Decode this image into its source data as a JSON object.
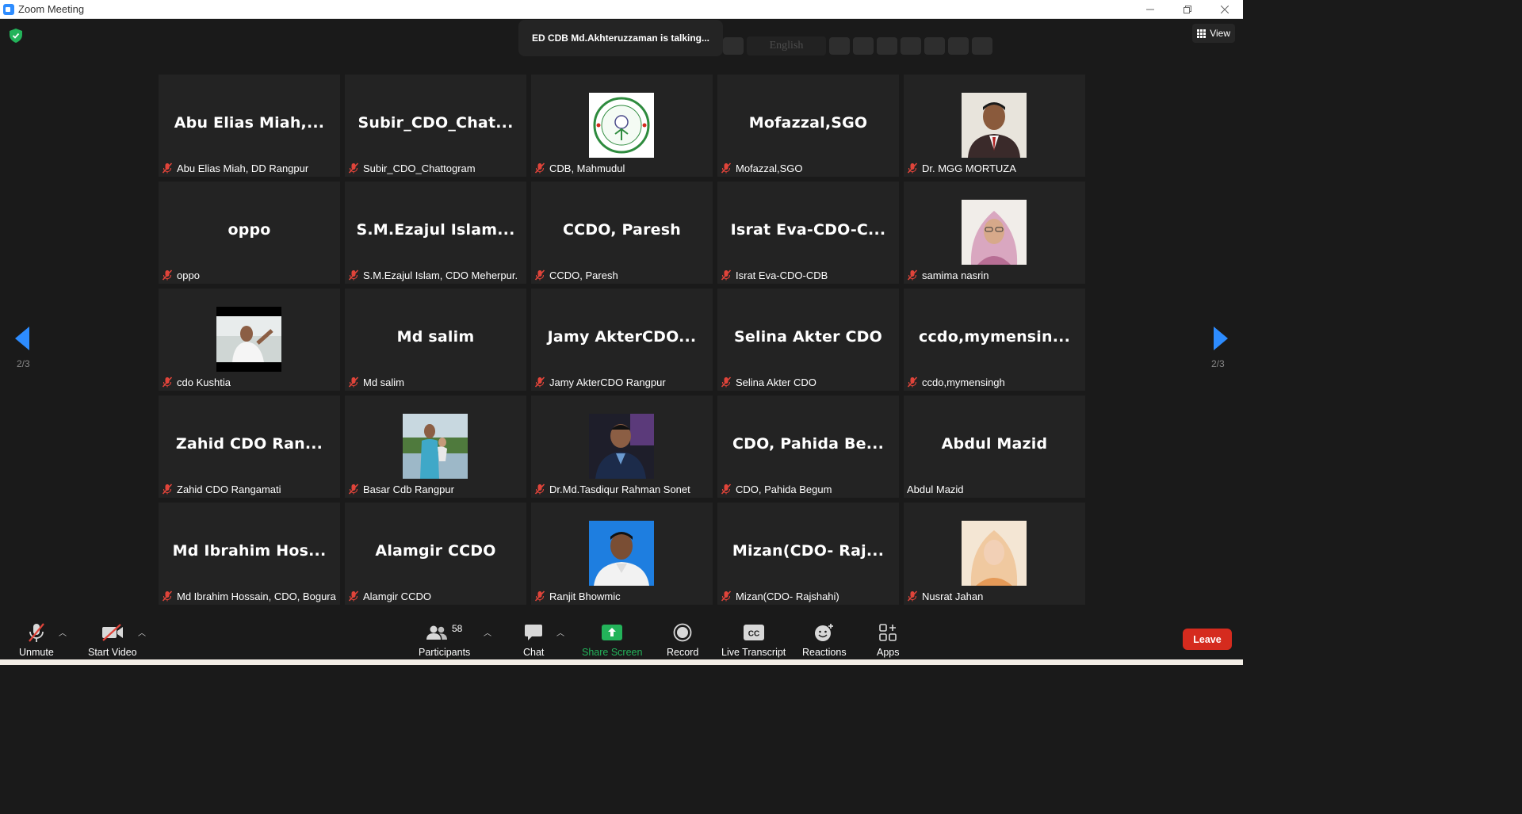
{
  "window": {
    "title": "Zoom Meeting",
    "controls": [
      "minimize-icon",
      "restore-icon",
      "close-icon"
    ]
  },
  "meeting": {
    "talking_indicator": "ED CDB Md.Akhteruzzaman is talking...",
    "interpretation_language": "English",
    "view_label": "View",
    "page_left": "2/3",
    "page_right": "2/3"
  },
  "tiles": [
    {
      "big": "Abu  Elias  Miah,...",
      "label": "Abu Elias Miah, DD Rangpur",
      "muted": true
    },
    {
      "big": "Subir_CDO_Chat...",
      "label": "Subir_CDO_Chattogram",
      "muted": true
    },
    {
      "big": "",
      "label": "CDB, Mahmudul",
      "muted": true,
      "photo": "logo"
    },
    {
      "big": "Mofazzal,SGO",
      "label": "Mofazzal,SGO",
      "muted": true
    },
    {
      "big": "",
      "label": "Dr. MGG MORTUZA",
      "muted": true,
      "photo": "man-suit"
    },
    {
      "big": "oppo",
      "label": "oppo",
      "muted": true
    },
    {
      "big": "S.M.Ezajul  Islam...",
      "label": "S.M.Ezajul Islam, CDO Meherpur.",
      "muted": true
    },
    {
      "big": "CCDO, Paresh",
      "label": "CCDO, Paresh",
      "muted": true
    },
    {
      "big": "Israt  Eva-CDO-C...",
      "label": "Israt Eva-CDO-CDB",
      "muted": true
    },
    {
      "big": "",
      "label": "samima nasrin",
      "muted": true,
      "photo": "woman-hijab"
    },
    {
      "big": "",
      "label": "cdo Kushtia",
      "muted": true,
      "photo": "man-outdoor"
    },
    {
      "big": "Md salim",
      "label": "Md salim",
      "muted": true
    },
    {
      "big": "Jamy  AkterCDO...",
      "label": "Jamy AkterCDO Rangpur",
      "muted": true
    },
    {
      "big": "Selina Akter CDO",
      "label": "Selina Akter CDO",
      "muted": true
    },
    {
      "big": "ccdo,mymensin...",
      "label": "ccdo,mymensingh",
      "muted": true
    },
    {
      "big": "Zahid  CDO  Ran...",
      "label": "Zahid CDO Rangamati",
      "muted": true
    },
    {
      "big": "",
      "label": "Basar Cdb Rangpur",
      "muted": true,
      "photo": "man-child"
    },
    {
      "big": "",
      "label": "Dr.Md.Tasdiqur Rahman Sonet",
      "muted": true,
      "photo": "man-dark"
    },
    {
      "big": "CDO,  Pahida  Be...",
      "label": "CDO, Pahida Begum",
      "muted": true
    },
    {
      "big": "Abdul Mazid",
      "label": "Abdul Mazid",
      "muted": false
    },
    {
      "big": "Md  Ibrahim  Hos...",
      "label": "Md Ibrahim Hossain, CDO, Bogura",
      "muted": true
    },
    {
      "big": "Alamgir CCDO",
      "label": "Alamgir CCDO",
      "muted": true
    },
    {
      "big": "",
      "label": "Ranjit Bhowmic",
      "muted": true,
      "photo": "man-blue"
    },
    {
      "big": "Mizan(CDO-  Raj...",
      "label": "Mizan(CDO- Rajshahi)",
      "muted": true
    },
    {
      "big": "",
      "label": "Nusrat Jahan",
      "muted": true,
      "photo": "woman-scarf"
    }
  ],
  "toolbar": {
    "unmute": "Unmute",
    "start_video": "Start Video",
    "participants": "Participants",
    "participants_count": "58",
    "chat": "Chat",
    "share_screen": "Share Screen",
    "record": "Record",
    "live_transcript": "Live Transcript",
    "cc": "CC",
    "reactions": "Reactions",
    "apps": "Apps",
    "leave": "Leave"
  },
  "colors": {
    "background": "#1a1a1a",
    "tile": "#232323",
    "accent_blue": "#2d8cff",
    "muted_red": "#e0443a",
    "share_green": "#23b35a",
    "leave_red": "#d52b1e"
  }
}
